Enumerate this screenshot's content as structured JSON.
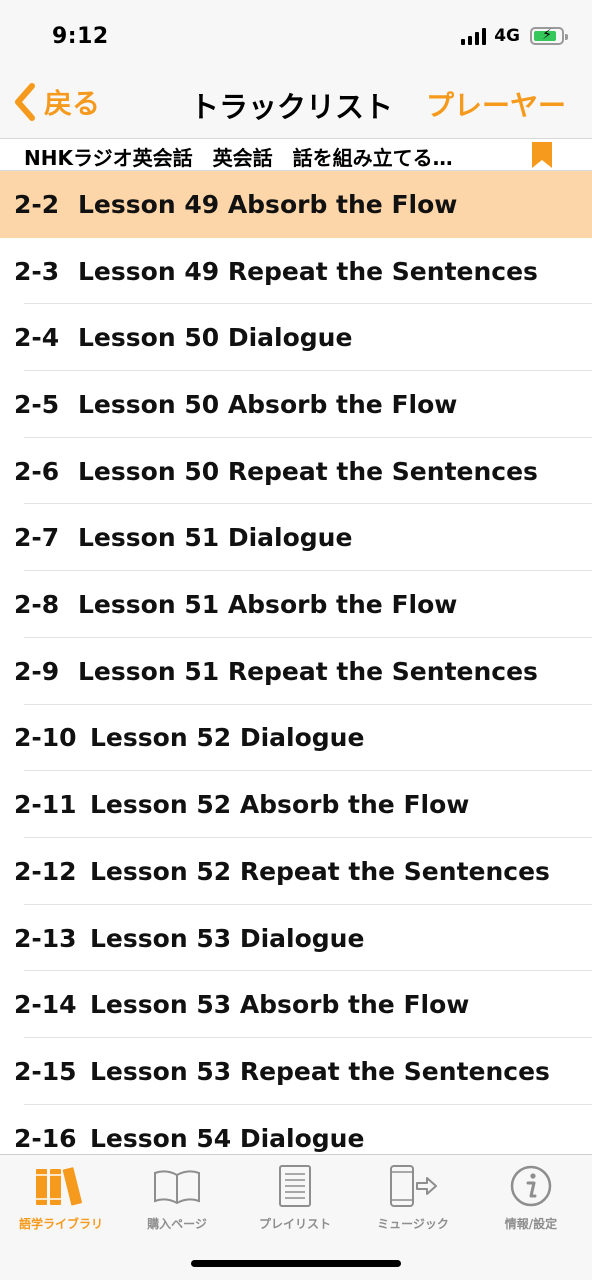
{
  "status_bar": {
    "time": "9:12",
    "network": "4G",
    "battery_level": 0.85,
    "charging": true
  },
  "nav": {
    "back_label": "戻る",
    "title": "トラックリスト",
    "player_label": "プレーヤー",
    "accent_color": "#f59a1d"
  },
  "subheader": {
    "text": "NHKラジオ英会話　英会話　話を組み立てる…",
    "bookmark_icon": "bookmark-icon"
  },
  "tracks": [
    {
      "num": "2-2",
      "title": "Lesson 49 Absorb the Flow",
      "selected": true
    },
    {
      "num": "2-3",
      "title": "Lesson 49 Repeat the Sentences"
    },
    {
      "num": "2-4",
      "title": "Lesson 50 Dialogue"
    },
    {
      "num": "2-5",
      "title": "Lesson 50 Absorb the Flow"
    },
    {
      "num": "2-6",
      "title": "Lesson 50 Repeat the Sentences"
    },
    {
      "num": "2-7",
      "title": "Lesson 51 Dialogue"
    },
    {
      "num": "2-8",
      "title": "Lesson 51 Absorb the Flow"
    },
    {
      "num": "2-9",
      "title": "Lesson 51 Repeat the Sentences"
    },
    {
      "num": "2-10",
      "title": "Lesson 52 Dialogue"
    },
    {
      "num": "2-11",
      "title": "Lesson 52 Absorb the Flow"
    },
    {
      "num": "2-12",
      "title": "Lesson 52 Repeat the Sentences"
    },
    {
      "num": "2-13",
      "title": "Lesson 53 Dialogue"
    },
    {
      "num": "2-14",
      "title": "Lesson 53 Absorb the Flow"
    },
    {
      "num": "2-15",
      "title": "Lesson 53 Repeat the Sentences"
    },
    {
      "num": "2-16",
      "title": "Lesson 54 Dialogue"
    }
  ],
  "selected_color": "#fcd6a9",
  "tab_bar": {
    "tabs": [
      {
        "label": "語学ライブラリ",
        "icon": "library-books-icon",
        "active": true
      },
      {
        "label": "購入ページ",
        "icon": "open-book-icon"
      },
      {
        "label": "プレイリスト",
        "icon": "playlist-document-icon"
      },
      {
        "label": "ミュージック",
        "icon": "phone-export-icon"
      },
      {
        "label": "情報/設定",
        "icon": "info-icon"
      }
    ]
  }
}
